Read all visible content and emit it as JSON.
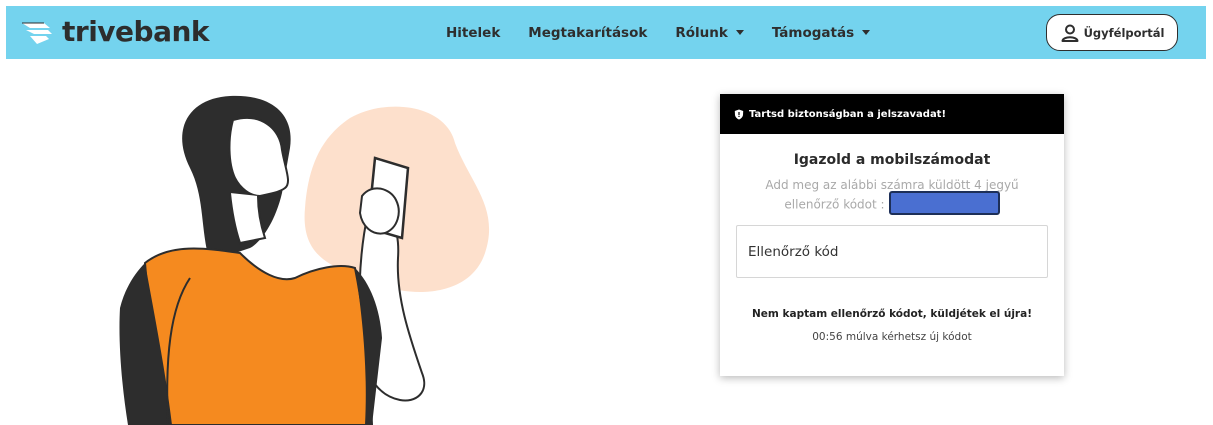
{
  "brand": {
    "name": "trivebank"
  },
  "nav": {
    "items": [
      {
        "label": "Hitelek",
        "dropdown": false
      },
      {
        "label": "Megtakarítások",
        "dropdown": false
      },
      {
        "label": "Rólunk",
        "dropdown": true
      },
      {
        "label": "Támogatás",
        "dropdown": true
      }
    ]
  },
  "portal": {
    "label": "Ügyfélportál",
    "icon": "user-icon"
  },
  "card": {
    "banner": "Tartsd biztonságban a jelszavadat!",
    "banner_icon": "shield-icon",
    "title": "Igazold a mobilszámodat",
    "description": "Add meg az alábbi számra küldött 4 jegyű ellenőrző kódot :",
    "input_placeholder": "Ellenőrző kód",
    "resend": "Nem kaptam ellenőrző kódot, küldjétek el újra!",
    "timer": "00:56 múlva kérhetsz új kódot"
  },
  "colors": {
    "header": "#74d3ee",
    "accent_orange": "#f58a1f",
    "blob": "#fde0cc",
    "mask": "#4a6fd1"
  }
}
